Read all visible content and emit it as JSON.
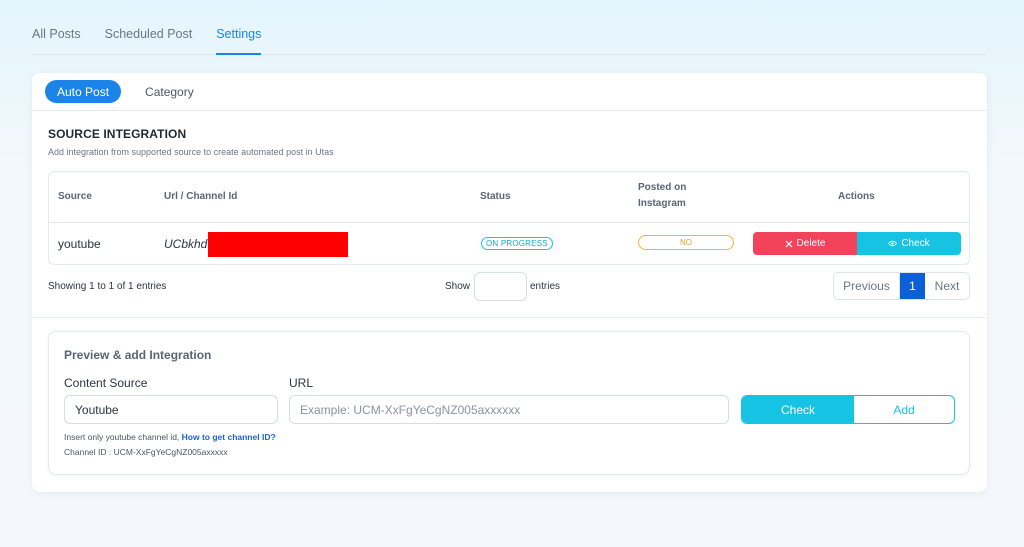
{
  "top_tabs": [
    {
      "label": "All Posts"
    },
    {
      "label": "Scheduled Post"
    },
    {
      "label": "Settings"
    }
  ],
  "sub_tabs": [
    {
      "label": "Auto Post"
    },
    {
      "label": "Category"
    }
  ],
  "section": {
    "title": "SOURCE INTEGRATION",
    "description": "Add integration from supported source to create automated post in Utas"
  },
  "table": {
    "headers": {
      "source": "Source",
      "url": "Url / Channel Id",
      "status": "Status",
      "posted_line1": "Posted on",
      "posted_line2": "Instagram",
      "actions": "Actions"
    },
    "rows": [
      {
        "source": "youtube",
        "url": "UCbkhd",
        "status": "ON PROGRESS",
        "posted": "NO",
        "delete_label": "Delete",
        "check_label": "Check"
      }
    ]
  },
  "footer": {
    "showing": "Showing 1 to 1 of 1 entries",
    "show_label": "Show",
    "entries_label": "entries",
    "pager": {
      "previous": "Previous",
      "current": "1",
      "next": "Next"
    }
  },
  "preview": {
    "title": "Preview & add Integration",
    "content_source_label": "Content Source",
    "content_source_value": "Youtube",
    "url_label": "URL",
    "url_placeholder": "Example: UCM-XxFgYeCgNZ005axxxxxx",
    "check_label": "Check",
    "add_label": "Add",
    "hint_text": "Insert only youtube channel id, ",
    "hint_link": "How to get channel ID?",
    "channel_example": "Channel ID : UCM-XxFgYeCgNZ005axxxxx"
  },
  "colors": {
    "primary": "#1b84e8",
    "danger": "#f2435a",
    "info": "#17c3e2",
    "warning": "#f0b340",
    "pager_active": "#0c5fd4"
  }
}
